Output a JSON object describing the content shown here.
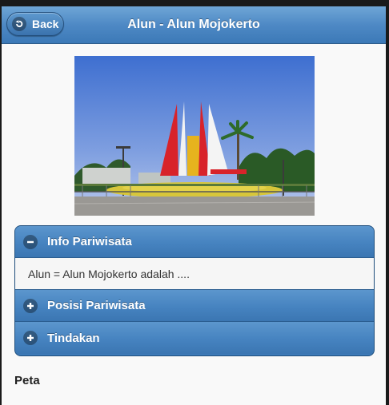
{
  "header": {
    "back_label": "Back",
    "title": "Alun - Alun Mojokerto"
  },
  "accordion": {
    "sections": [
      {
        "label": "Info Pariwisata",
        "expanded": true,
        "icon": "minus-icon",
        "content": "Alun = Alun Mojokerto adalah ...."
      },
      {
        "label": "Posisi Pariwisata",
        "expanded": false,
        "icon": "plus-icon"
      },
      {
        "label": "Tindakan",
        "expanded": false,
        "icon": "plus-icon"
      }
    ]
  },
  "map": {
    "heading": "Peta"
  },
  "colors": {
    "header_blue": "#4e89c5",
    "accordion_blue": "#4683c0",
    "monument_red": "#d8232a"
  }
}
